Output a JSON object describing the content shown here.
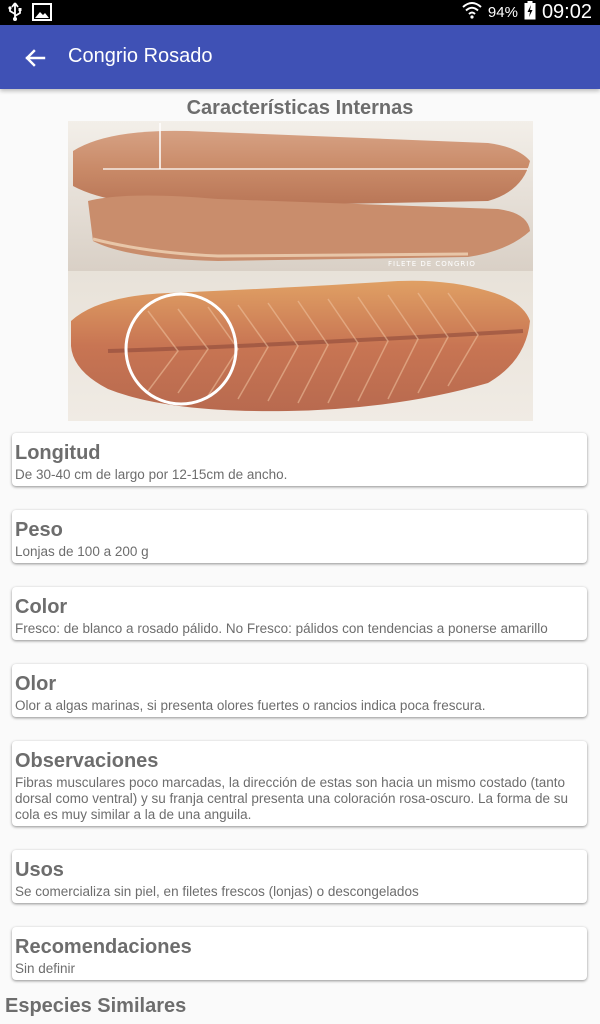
{
  "status_bar": {
    "battery_percent": "94%",
    "time": "09:02",
    "icons": [
      "usb-icon",
      "image-notification-icon",
      "wifi-icon",
      "battery-icon"
    ]
  },
  "app_bar": {
    "title": "Congrio Rosado",
    "back_icon": "arrow-left-icon",
    "color": "#3f51b5"
  },
  "section_title": "Características Internas",
  "photo": {
    "watermark": "FILETE DE CONGRIO"
  },
  "cards": [
    {
      "title": "Longitud",
      "text": "De 30-40 cm de largo por 12-15cm de ancho."
    },
    {
      "title": "Peso",
      "text": "Lonjas de 100 a 200 g"
    },
    {
      "title": "Color",
      "text": "Fresco: de blanco a rosado pálido. No Fresco: pálidos con tendencias a ponerse amarillo"
    },
    {
      "title": "Olor",
      "text": "Olor a algas marinas, si presenta olores fuertes o rancios indica poca frescura."
    },
    {
      "title": "Observaciones",
      "text": "Fibras musculares poco marcadas, la dirección de estas son hacia un mismo costado (tanto dorsal como ventral) y su franja central presenta una coloración rosa-oscuro. La forma de su cola es muy similar a la de una anguila."
    },
    {
      "title": "Usos",
      "text": "Se comercializa sin piel, en filetes frescos (lonjas) o descongelados"
    },
    {
      "title": "Recomendaciones",
      "text": "Sin definir"
    }
  ],
  "similar_species_heading": "Especies Similares"
}
